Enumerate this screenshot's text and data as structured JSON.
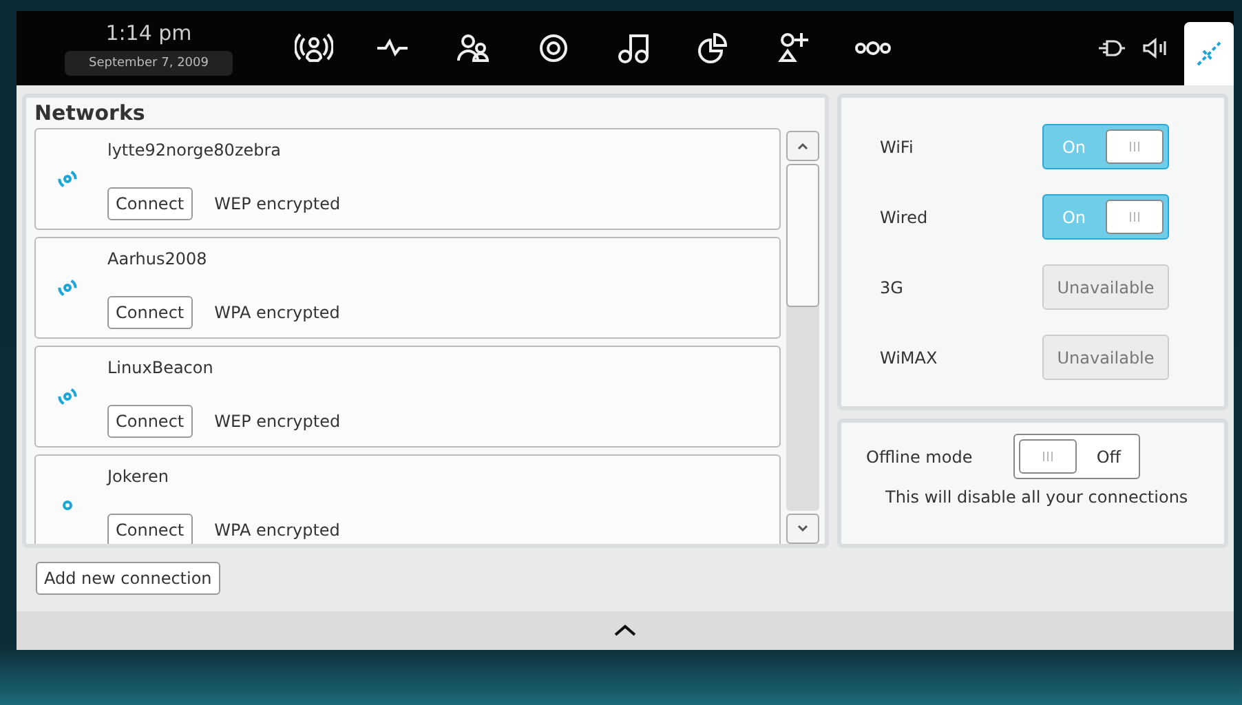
{
  "top_bar": {
    "time": "1:14 pm",
    "date": "September  7, 2009",
    "apps": [
      {
        "selected": false
      },
      {
        "selected": false
      },
      {
        "selected": false
      },
      {
        "selected": false
      },
      {
        "selected": false
      },
      {
        "selected": false
      },
      {
        "selected": false
      },
      {
        "selected": false
      }
    ],
    "network_button": {
      "selected": true
    }
  },
  "networks": {
    "title": "Networks",
    "items": [
      {
        "name": "lytte92norge80zebra",
        "kind": "strong",
        "button": "Connect",
        "security": "WEP encrypted"
      },
      {
        "name": "Aarhus2008",
        "kind": "strong",
        "button": "Connect",
        "security": "WPA encrypted"
      },
      {
        "name": "LinuxBeacon",
        "kind": "strong",
        "button": "Connect",
        "security": "WEP encrypted"
      },
      {
        "name": "Jokeren",
        "kind": "weak",
        "button": "Connect",
        "security": "WPA encrypted"
      }
    ],
    "add_button": "Add new connection"
  },
  "technologies": [
    {
      "label": "WiFi",
      "kind": "toggle",
      "on": true,
      "state_text": "On"
    },
    {
      "label": "Wired",
      "kind": "toggle",
      "on": true,
      "state_text": "On"
    },
    {
      "label": "3G",
      "kind": "unavailable",
      "status": "Unavailable"
    },
    {
      "label": "WiMAX",
      "kind": "unavailable",
      "status": "Unavailable"
    }
  ],
  "offline": {
    "label": "Offline mode",
    "on": false,
    "state_text": "Off",
    "note": "This will disable all your connections"
  }
}
